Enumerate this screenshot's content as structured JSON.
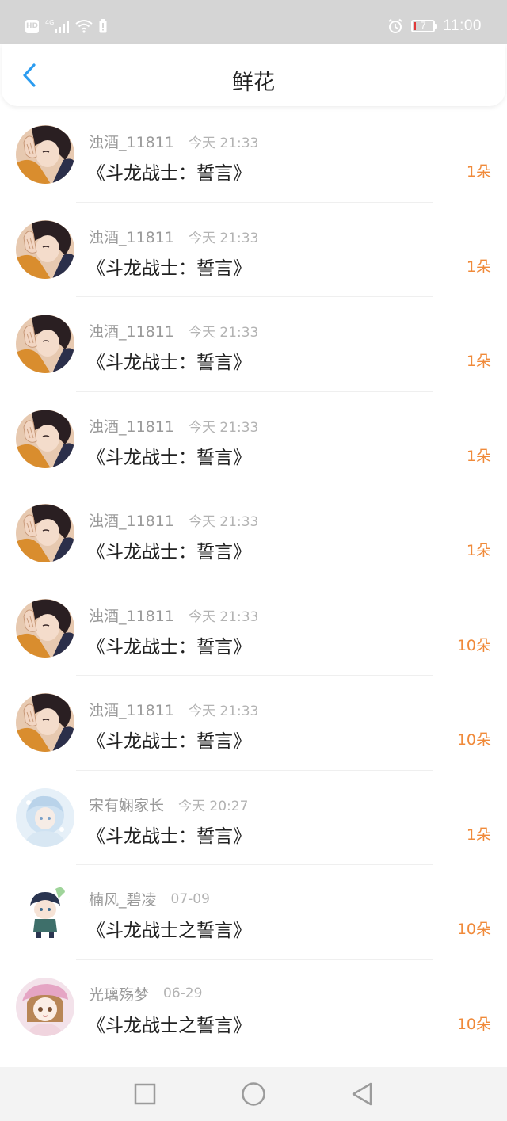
{
  "status_bar": {
    "hd_badge": "HD",
    "network": "4G",
    "battery_level": "7",
    "time": "11:00",
    "icons": [
      "hd-icon",
      "signal-icon",
      "wifi-icon",
      "battery-alert-icon",
      "alarm-icon",
      "battery-icon"
    ]
  },
  "header": {
    "back_icon": "chevron-left-icon",
    "title": "鲜花"
  },
  "items": [
    {
      "user": "浊酒_11811",
      "time": "今天 21:33",
      "book": "《斗龙战士：誓言》",
      "count": "1朵",
      "avatar": "avatar-dark-hair"
    },
    {
      "user": "浊酒_11811",
      "time": "今天 21:33",
      "book": "《斗龙战士：誓言》",
      "count": "1朵",
      "avatar": "avatar-dark-hair"
    },
    {
      "user": "浊酒_11811",
      "time": "今天 21:33",
      "book": "《斗龙战士：誓言》",
      "count": "1朵",
      "avatar": "avatar-dark-hair"
    },
    {
      "user": "浊酒_11811",
      "time": "今天 21:33",
      "book": "《斗龙战士：誓言》",
      "count": "1朵",
      "avatar": "avatar-dark-hair"
    },
    {
      "user": "浊酒_11811",
      "time": "今天 21:33",
      "book": "《斗龙战士：誓言》",
      "count": "1朵",
      "avatar": "avatar-dark-hair"
    },
    {
      "user": "浊酒_11811",
      "time": "今天 21:33",
      "book": "《斗龙战士：誓言》",
      "count": "10朵",
      "avatar": "avatar-dark-hair"
    },
    {
      "user": "浊酒_11811",
      "time": "今天 21:33",
      "book": "《斗龙战士：誓言》",
      "count": "10朵",
      "avatar": "avatar-dark-hair"
    },
    {
      "user": "宋有娴家长",
      "time": "今天 20:27",
      "book": "《斗龙战士：誓言》",
      "count": "1朵",
      "avatar": "avatar-light-blue"
    },
    {
      "user": "楠风_碧凌",
      "time": "07-09",
      "book": "《斗龙战士之誓言》",
      "count": "10朵",
      "avatar": "avatar-chibi"
    },
    {
      "user": "光璃殇梦",
      "time": "06-29",
      "book": "《斗龙战士之誓言》",
      "count": "10朵",
      "avatar": "avatar-pink-hat"
    }
  ],
  "nav_bar": {
    "icons": [
      "recent-apps-icon",
      "home-icon",
      "back-icon"
    ]
  },
  "colors": {
    "status_bar_bg": "#d5d5d5",
    "accent_blue": "#2b9cf0",
    "count_orange": "#f08a3a",
    "username_gray": "#9a9a9a"
  }
}
